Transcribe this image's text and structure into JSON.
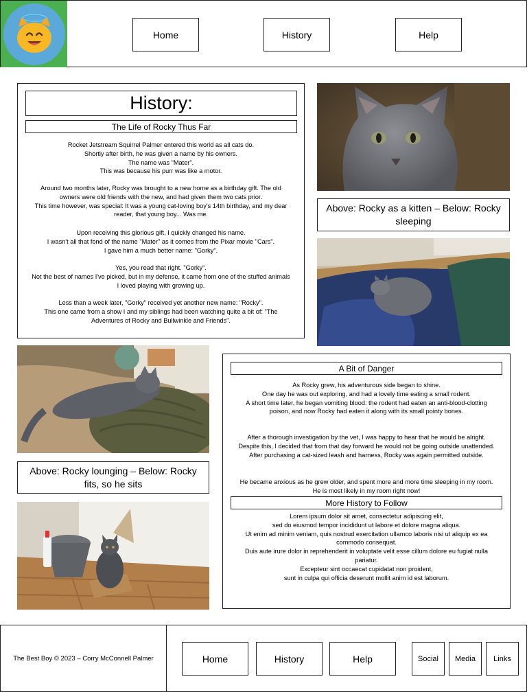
{
  "header": {
    "logo_icon": "smiling-cat-with-halo-icon",
    "nav": [
      {
        "label": "Home"
      },
      {
        "label": "History"
      },
      {
        "label": "Help"
      }
    ]
  },
  "history": {
    "title": "History:",
    "subtitle": "The Life of Rocky Thus Far",
    "paragraphs": [
      [
        "Rocket Jetstream Squirrel Palmer entered this world as all cats do.",
        "Shortly after birth, he was given a name by his owners.",
        "The name was \"Mater\".",
        "This was because his purr was like a motor."
      ],
      [
        "Around two months later, Rocky was brought to a new home as a birthday gift. The old",
        "owners were old friends with the new, and had given them two cats prior.",
        "This time however, was special: It was a young cat-loving boy's 14th birthday, and my dear",
        "reader, that young boy... Was me."
      ],
      [
        "Upon receiving this glorious gift, I quickly changed his name.",
        "I wasn't all that fond of the name \"Mater\" as it comes from the Pixar movie \"Cars\".",
        "I gave him a much better name: \"Gorky\"."
      ],
      [
        "Yes, you read that right. \"Gorky\".",
        "Not the best of names I've picked, but in my defense, it came from one of the stuffed animals",
        "I loved playing with growing up."
      ],
      [
        "Less than a week later, \"Gorky\" received yet another new name: \"Rocky\".",
        "This one came from a show I and my siblings had been watching quite a bit of: \"The",
        "Adventures of Rocky and Bullwinkle and Friends\"."
      ]
    ]
  },
  "captions": {
    "kitten": "Above: Rocky as a kitten – Below: Rocky sleeping",
    "lounging": "Above: Rocky lounging – Below: Rocky fits, so he sits"
  },
  "danger": {
    "title": "A Bit of Danger",
    "paragraphs": [
      [
        "As Rocky grew, his adventurous side began to shine.",
        "One day he was out exploring, and had a lovely time eating a small rodent.",
        "A short time later, he began vomiting blood: the rodent had eaten an anti-blood-clotting",
        "poison, and now Rocky had eaten it along with its small pointy bones."
      ],
      [
        "After a thorough investigation by the vet, I was happy to hear that he would be alright.",
        "Despite this, I decided that from that day forward he would not be going outside unattended.",
        "After purchasing a cat-sized leash and harness, Rocky was again permitted outside."
      ],
      [
        "He became anxious as he grew older, and spent more and more time sleeping in my room.",
        "He is most likely in my room right now!"
      ]
    ]
  },
  "more": {
    "title": "More History to Follow",
    "lines": [
      "Lorem ipsum dolor sit amet, consectetur adipiscing elit,",
      "sed do eiusmod tempor incididunt ut labore et dolore magna aliqua.",
      "Ut enim ad minim veniam, quis nostrud exercitation ullamco laboris nisi ut aliquip ex ea",
      "commodo consequat.",
      "Duis aute irure dolor in reprehenderit in voluptate velit esse cillum dolore eu fugiat nulla",
      "pariatur.",
      "Excepteur sint occaecat cupidatat non proident,",
      "sunt in culpa qui officia deserunt mollit anim id est laborum."
    ]
  },
  "footer": {
    "copyright": "The Best Boy © 2023 – Corry McConnell Palmer",
    "nav": [
      {
        "label": "Home"
      },
      {
        "label": "History"
      },
      {
        "label": "Help"
      }
    ],
    "social": [
      {
        "label": "Social"
      },
      {
        "label": "Media"
      },
      {
        "label": "Links"
      }
    ]
  }
}
